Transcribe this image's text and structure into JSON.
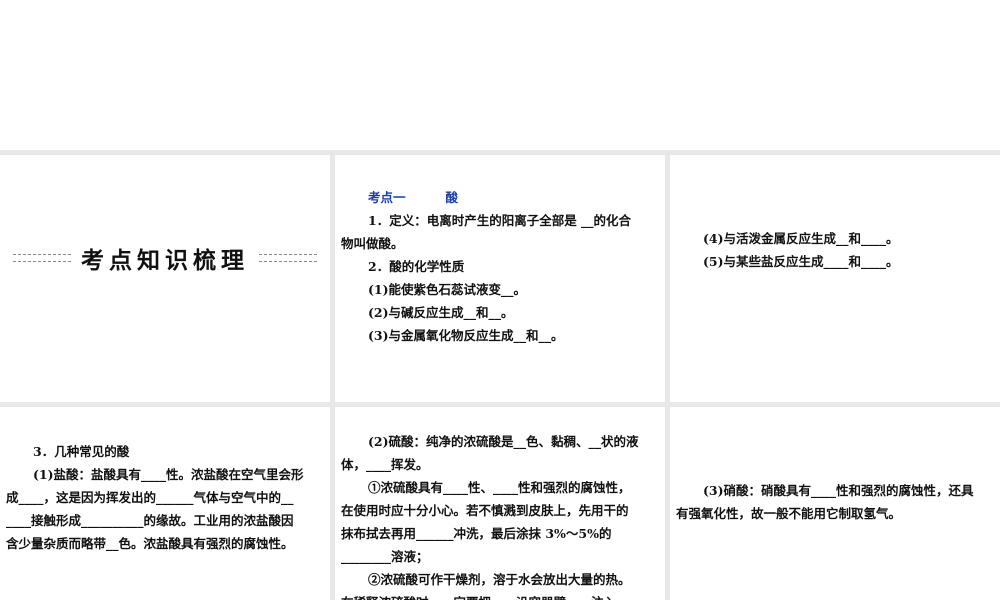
{
  "slides": [
    {
      "title": "考点知识梳理"
    },
    {
      "heading": "考点一",
      "heading_topic": "酸",
      "lines": [
        {
          "text": "1．定义：电离时产生的阳离子全部是 __的化合",
          "indent": true
        },
        {
          "text": "物叫做酸。",
          "indent": false
        },
        {
          "text": "2．酸的化学性质",
          "indent": true
        },
        {
          "text": "(1)能使紫色石蕊试液变__。",
          "indent": true
        },
        {
          "text": "(2)与碱反应生成__和__。",
          "indent": true
        },
        {
          "text": "(3)与金属氧化物反应生成__和__。",
          "indent": true
        }
      ]
    },
    {
      "lines": [
        {
          "text": "(4)与活泼金属反应生成__和____。",
          "indent": true
        },
        {
          "text": "(5)与某些盐反应生成____和____。",
          "indent": true
        }
      ]
    },
    {
      "lines": [
        {
          "text": "3．几种常见的酸",
          "indent": true
        },
        {
          "text": "(1)盐酸：盐酸具有____性。浓盐酸在空气里会形",
          "indent": true
        },
        {
          "text": "成____，这是因为挥发出的______气体与空气中的__",
          "indent": false
        },
        {
          "text": "____接触形成__________的缘故。工业用的浓盐酸因",
          "indent": false
        },
        {
          "text": "含少量杂质而略带__色。浓盐酸具有强烈的腐蚀性。",
          "indent": false
        }
      ]
    },
    {
      "lines": [
        {
          "text": "(2)硫酸：纯净的浓硫酸是__色、黏稠、__状的液",
          "indent": true
        },
        {
          "text": "体，____挥发。",
          "indent": false
        },
        {
          "text": "①浓硫酸具有____性、____性和强烈的腐蚀性，",
          "indent": true
        },
        {
          "text": "在使用时应十分小心。若不慎溅到皮肤上，先用干的",
          "indent": false
        },
        {
          "text": "抹布拭去再用______冲洗，最后涂抹 3%～5%的",
          "indent": false
        },
        {
          "text": "________溶液；",
          "indent": false
        },
        {
          "text": "②浓硫酸可作干燥剂，溶于水会放出大量的热。",
          "indent": true
        },
        {
          "text": "在稀释浓硫酸时，一定要把____沿容器壁____注入",
          "indent": false
        }
      ]
    },
    {
      "lines": [
        {
          "text": "(3)硝酸：硝酸具有____性和强烈的腐蚀性，还具",
          "indent": true
        },
        {
          "text": "有强氧化性，故一般不能用它制取氢气。",
          "indent": false
        }
      ]
    }
  ],
  "colors": {
    "gap": "#e8e8e8",
    "heading": "#1a3fa8"
  }
}
